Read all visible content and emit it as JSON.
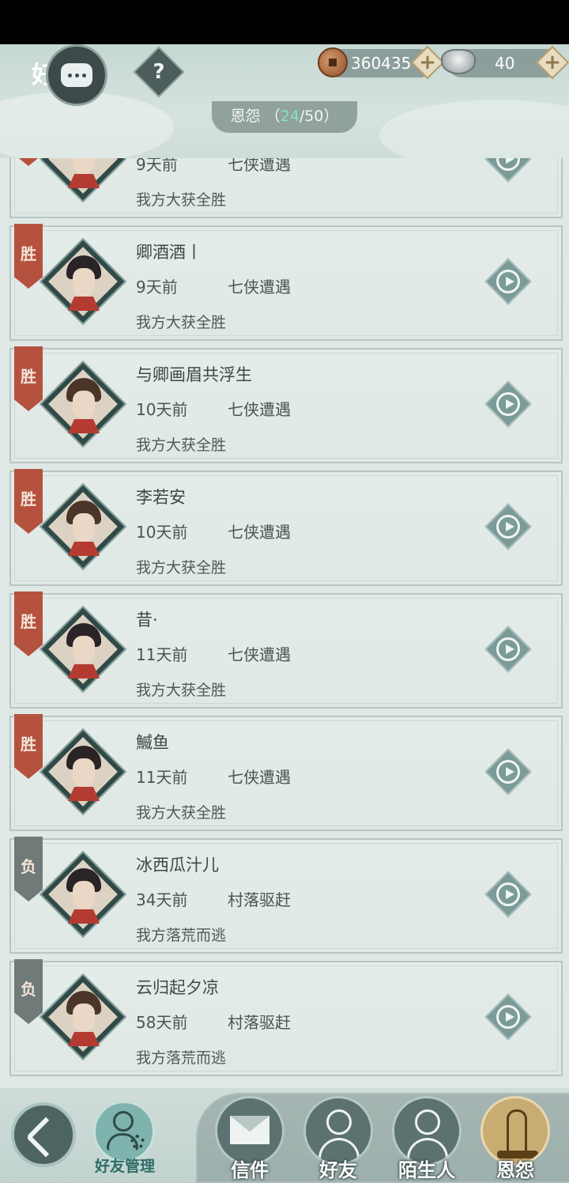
{
  "header": {
    "chat_glyph": "好",
    "help_label": "?",
    "copper": "360435",
    "silver": "40",
    "plus_label": "+",
    "tab_prefix": "恩怨 （",
    "tab_current": "24",
    "tab_total": "/50）"
  },
  "records": [
    {
      "tag": "",
      "name": "",
      "time": "9天前",
      "mode": "七侠遭遇",
      "result": "我方大获全胜",
      "hair": "black"
    },
    {
      "tag": "胜",
      "name": "卿酒酒丨",
      "time": "9天前",
      "mode": "七侠遭遇",
      "result": "我方大获全胜",
      "hair": "black"
    },
    {
      "tag": "胜",
      "name": "与卿画眉共浮生",
      "time": "10天前",
      "mode": "七侠遭遇",
      "result": "我方大获全胜",
      "hair": "brown"
    },
    {
      "tag": "胜",
      "name": "李若安",
      "time": "10天前",
      "mode": "七侠遭遇",
      "result": "我方大获全胜",
      "hair": "brown"
    },
    {
      "tag": "胜",
      "name": "昔·",
      "time": "11天前",
      "mode": "七侠遭遇",
      "result": "我方大获全胜",
      "hair": "black"
    },
    {
      "tag": "胜",
      "name": "鰄鱼",
      "time": "11天前",
      "mode": "七侠遭遇",
      "result": "我方大获全胜",
      "hair": "black"
    },
    {
      "tag": "负",
      "name": "冰西瓜汁儿",
      "time": "34天前",
      "mode": "村落驱赶",
      "result": "我方落荒而逃",
      "hair": "black"
    },
    {
      "tag": "负",
      "name": "云归起夕凉",
      "time": "58天前",
      "mode": "村落驱赶",
      "result": "我方落荒而逃",
      "hair": "brown"
    }
  ],
  "bottom": {
    "manage_label": "好友管理",
    "tabs": [
      {
        "label": "信件",
        "icon": "envelope-icon"
      },
      {
        "label": "好友",
        "icon": "friend-icon"
      },
      {
        "label": "陌生人",
        "icon": "stranger-icon"
      },
      {
        "label": "恩怨",
        "icon": "grudge-icon"
      }
    ]
  },
  "colors": {
    "win_ribbon": "#b5523f",
    "lose_ribbon": "#6f7a79",
    "accent_count": "#7fe8b8",
    "active_tab": "#c9ac72"
  }
}
